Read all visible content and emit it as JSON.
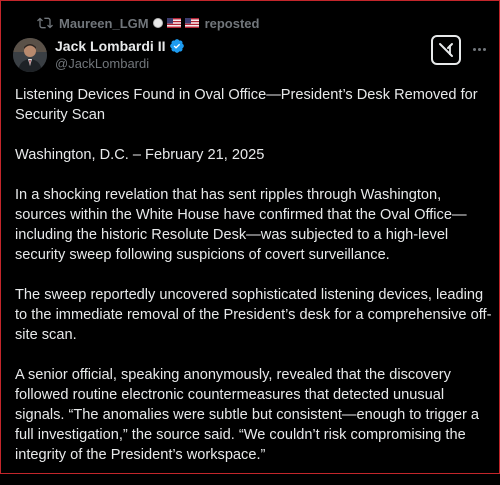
{
  "repost": {
    "username": "Maureen_LGM",
    "label": "reposted",
    "icon": "retweet-icon"
  },
  "author": {
    "name": "Jack Lombardi II",
    "handle": "@JackLombardi",
    "verified": true,
    "verified_color": "#1d9bf0"
  },
  "actions": {
    "grok_icon": "grok-icon",
    "more_icon": "more-icon"
  },
  "post": {
    "paragraphs": [
      "Listening Devices Found in Oval Office—President’s Desk Removed for Security Scan",
      "Washington, D.C. – February 21, 2025",
      "In a shocking revelation that has sent ripples through Washington, sources within the White House have confirmed that the Oval Office—including the historic Resolute Desk—was subjected to a high-level security sweep following suspicions of covert surveillance.",
      "The sweep reportedly uncovered sophisticated listening devices, leading to the immediate removal of the President’s desk for a comprehensive off-site scan.",
      "A senior official, speaking anonymously, revealed that the discovery followed routine electronic countermeasures that detected unusual signals. “The anomalies were subtle but consistent—enough to trigger a full investigation,” the source said. “We couldn’t risk compromising the integrity of the President’s workspace.”"
    ]
  },
  "colors": {
    "background": "#000000",
    "text": "#e7e9ea",
    "secondary_text": "#71767b",
    "frame_border": "#c3262b"
  }
}
